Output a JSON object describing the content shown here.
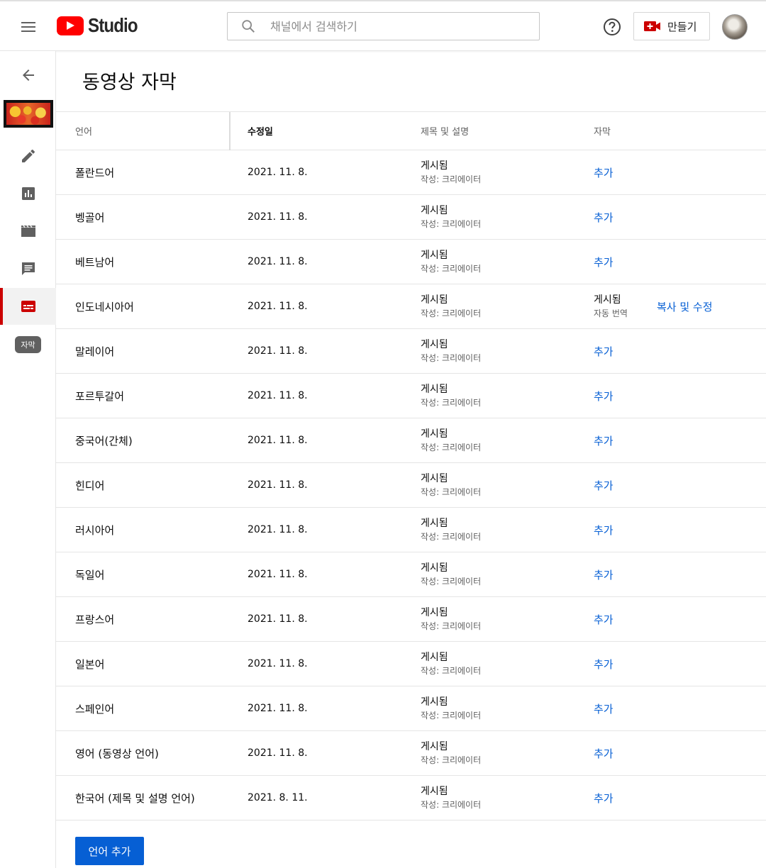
{
  "header": {
    "brand": "Studio",
    "search_placeholder": "채널에서 검색하기",
    "create_label": "만들기"
  },
  "sidebar": {
    "tooltip": "자막",
    "items": [
      "back-arrow-icon",
      "edit-icon",
      "analytics-icon",
      "editor-icon",
      "comments-icon",
      "subtitles-icon"
    ]
  },
  "page": {
    "title": "동영상 자막"
  },
  "table": {
    "headers": {
      "language": "언어",
      "modified": "수정일",
      "title_desc": "제목 및 설명",
      "subtitles": "자막"
    },
    "rows": [
      {
        "language": "폴란드어",
        "date": "2021. 11. 8.",
        "status": "게시됨",
        "author": "작성: 크리에이터",
        "action": "추가"
      },
      {
        "language": "벵골어",
        "date": "2021. 11. 8.",
        "status": "게시됨",
        "author": "작성: 크리에이터",
        "action": "추가"
      },
      {
        "language": "베트남어",
        "date": "2021. 11. 8.",
        "status": "게시됨",
        "author": "작성: 크리에이터",
        "action": "추가"
      },
      {
        "language": "인도네시아어",
        "date": "2021. 11. 8.",
        "status": "게시됨",
        "author": "작성: 크리에이터",
        "sub_status": "게시됨",
        "sub_author": "자동 번역",
        "action": "복사 및 수정"
      },
      {
        "language": "말레이어",
        "date": "2021. 11. 8.",
        "status": "게시됨",
        "author": "작성: 크리에이터",
        "action": "추가"
      },
      {
        "language": "포르투갈어",
        "date": "2021. 11. 8.",
        "status": "게시됨",
        "author": "작성: 크리에이터",
        "action": "추가"
      },
      {
        "language": "중국어(간체)",
        "date": "2021. 11. 8.",
        "status": "게시됨",
        "author": "작성: 크리에이터",
        "action": "추가"
      },
      {
        "language": "힌디어",
        "date": "2021. 11. 8.",
        "status": "게시됨",
        "author": "작성: 크리에이터",
        "action": "추가"
      },
      {
        "language": "러시아어",
        "date": "2021. 11. 8.",
        "status": "게시됨",
        "author": "작성: 크리에이터",
        "action": "추가"
      },
      {
        "language": "독일어",
        "date": "2021. 11. 8.",
        "status": "게시됨",
        "author": "작성: 크리에이터",
        "action": "추가"
      },
      {
        "language": "프랑스어",
        "date": "2021. 11. 8.",
        "status": "게시됨",
        "author": "작성: 크리에이터",
        "action": "추가"
      },
      {
        "language": "일본어",
        "date": "2021. 11. 8.",
        "status": "게시됨",
        "author": "작성: 크리에이터",
        "action": "추가"
      },
      {
        "language": "스페인어",
        "date": "2021. 11. 8.",
        "status": "게시됨",
        "author": "작성: 크리에이터",
        "action": "추가"
      },
      {
        "language": "영어 (동영상 언어)",
        "date": "2021. 11. 8.",
        "status": "게시됨",
        "author": "작성: 크리에이터",
        "action": "추가"
      },
      {
        "language": "한국어 (제목 및 설명 언어)",
        "date": "2021. 8. 11.",
        "status": "게시됨",
        "author": "작성: 크리에이터",
        "action": "추가"
      }
    ]
  },
  "footer": {
    "add_language": "언어 추가"
  },
  "colors": {
    "brand_red": "#ff0000",
    "active_red": "#cc0000",
    "link_blue": "#065fd4"
  }
}
